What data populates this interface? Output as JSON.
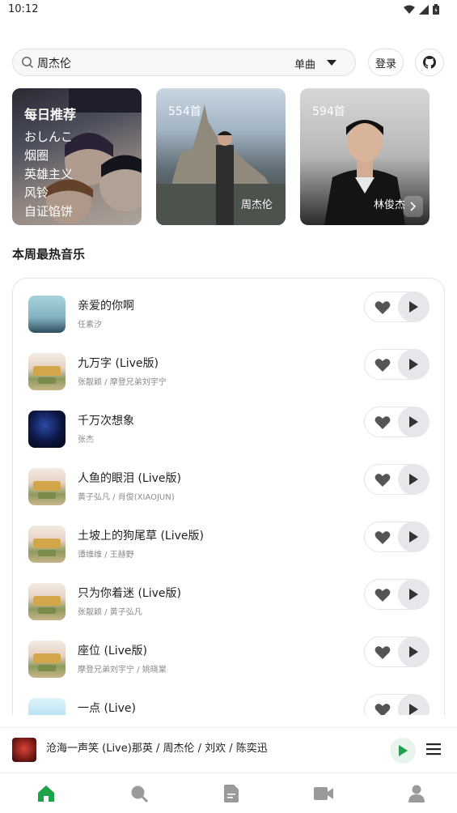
{
  "status_bar": {
    "time": "10:12"
  },
  "search": {
    "value": "周杰伦",
    "type_label": "单曲",
    "login_label": "登录"
  },
  "cards": {
    "daily": {
      "title": "每日推荐",
      "items": [
        "おしんこ",
        "烟圈",
        "英雄主义",
        "风铃",
        "自证馅饼"
      ]
    },
    "playlists": [
      {
        "count": "554首",
        "artist": "周杰伦"
      },
      {
        "count": "594首",
        "artist": "林俊杰"
      }
    ]
  },
  "section": {
    "title": "本周最热音乐"
  },
  "songs": [
    {
      "title": "亲爱的你啊",
      "artist": "任素汐"
    },
    {
      "title": "九万字 (Live版)",
      "artist": "张靓颖 / 摩登兄弟刘宇宁"
    },
    {
      "title": "千万次想象",
      "artist": "张杰"
    },
    {
      "title": "人鱼的眼泪 (Live版)",
      "artist": "黄子弘凡 / 肖俊(XIAOJUN)"
    },
    {
      "title": "土坡上的狗尾草 (Live版)",
      "artist": "谭维维 / 王赫野"
    },
    {
      "title": "只为你着迷 (Live版)",
      "artist": "张靓颖 / 黄子弘凡"
    },
    {
      "title": "座位 (Live版)",
      "artist": "摩登兄弟刘宇宁 / 姚晓棠"
    },
    {
      "title": "一点 (Live)",
      "artist": ""
    }
  ],
  "player": {
    "now_playing": "沧海一声笑 (Live)那英 / 周杰伦 / 刘欢 / 陈奕迅"
  },
  "colors": {
    "accent_green": "#1fa34a",
    "nav_icon_gray": "#9a9a9a"
  },
  "icons": {
    "bottom_nav": [
      "home-icon",
      "search-icon",
      "document-icon",
      "video-icon",
      "profile-icon"
    ]
  }
}
